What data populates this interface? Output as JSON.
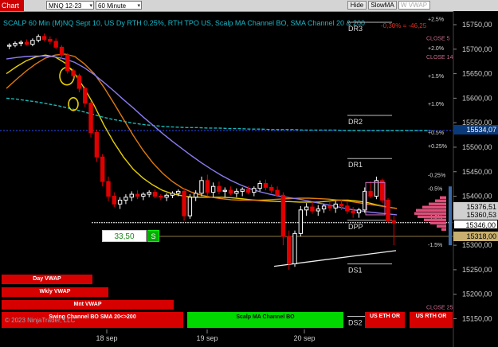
{
  "toolbar": {
    "chart_tab": "Chart",
    "instrument": "MNQ 12-23",
    "interval": "60 Minute",
    "hide_btn": "Hide",
    "slowma_btn": "SlowMA",
    "wvwap_btn": "W VWAP"
  },
  "title": "SCALP 60 Min (M)NQ Sept 10, US Dy RTH 0.25%, RTH TPO US, Scalp MA Channel BO, SMA Channel 20 & 200",
  "change_readout": "-0,30% = -46,25",
  "percent_labels": [
    "+2.5%",
    "+2.0%",
    "+1.5%",
    "+1.0%",
    "+0.5%",
    "+0.25%",
    "-0.25%",
    "-0.5%",
    "-1.0%",
    "-1.5%"
  ],
  "close_labels": [
    "CLOSE 5",
    "CLOSE 14",
    "CLOSE 25"
  ],
  "level_labels": [
    "DR3",
    "DR2",
    "DR1",
    "DPP",
    "DS1",
    "DS2"
  ],
  "y_ticks": [
    "15750,00",
    "15700,00",
    "15650,00",
    "15600,00",
    "15550,00",
    "15500,00",
    "15450,00",
    "15400,00",
    "15350,00",
    "15300,00",
    "15250,00",
    "15200,00",
    "15150,00"
  ],
  "x_ticks": [
    "18 sep",
    "19 sep",
    "20 sep"
  ],
  "price_badges": {
    "blue_line": "15534,07",
    "current": "15346,00",
    "entry": "15318,00",
    "partial_1": "15360,53",
    "partial_2": "15376,51"
  },
  "order_qty": "33,50",
  "order_qty_btn": "S",
  "buttons": {
    "day_vwap": "Day VWAP",
    "wkly_vwap": "Wkly VWAP",
    "mnt_vwap": "Mnt VWAP",
    "swing_channel": "Swing Channel BO SMA 20<>200",
    "scalp_ma": "Scalp MA Channel BO",
    "us_eth_or": "US ETH OR",
    "us_rth_or": "US RTH OR"
  },
  "copyright": "© 2023 NinjaTrader, LLC",
  "colors": {
    "up_candle": "#ffffff",
    "down_candle": "#e00000",
    "yellow_ma": "#e8d000",
    "orange_ma": "#e07a10",
    "purple_ma": "#8a7cf0",
    "teal_ma": "#18b8b8",
    "blue_level": "#2a4fff",
    "button_red": "#d60000",
    "button_green": "#00d800"
  },
  "chart_data": {
    "type": "candlestick",
    "title": "SCALP 60 Min (M)NQ Sept 10, US Dy RTH 0.25%, RTH TPO US, Scalp MA Channel BO, SMA Channel 20 & 200",
    "ylim": [
      15130,
      15770
    ],
    "x_categories": [
      "18 sep",
      "19 sep",
      "20 sep"
    ],
    "candles": [
      [
        15706,
        15712,
        15700,
        15708
      ],
      [
        15708,
        15716,
        15704,
        15712
      ],
      [
        15712,
        15718,
        15706,
        15714
      ],
      [
        15714,
        15720,
        15708,
        15710
      ],
      [
        15710,
        15722,
        15706,
        15718
      ],
      [
        15718,
        15730,
        15714,
        15726
      ],
      [
        15726,
        15732,
        15716,
        15720
      ],
      [
        15720,
        15726,
        15710,
        15716
      ],
      [
        15716,
        15722,
        15700,
        15704
      ],
      [
        15704,
        15708,
        15680,
        15688
      ],
      [
        15688,
        15692,
        15650,
        15656
      ],
      [
        15656,
        15660,
        15640,
        15646
      ],
      [
        15646,
        15650,
        15612,
        15620
      ],
      [
        15620,
        15624,
        15582,
        15590
      ],
      [
        15590,
        15594,
        15520,
        15530
      ],
      [
        15530,
        15536,
        15470,
        15480
      ],
      [
        15480,
        15486,
        15420,
        15430
      ],
      [
        15430,
        15440,
        15390,
        15400
      ],
      [
        15400,
        15408,
        15378,
        15384
      ],
      [
        15384,
        15398,
        15374,
        15392
      ],
      [
        15392,
        15404,
        15384,
        15398
      ],
      [
        15398,
        15410,
        15390,
        15404
      ],
      [
        15404,
        15412,
        15394,
        15400
      ],
      [
        15400,
        15408,
        15392,
        15404
      ],
      [
        15404,
        15412,
        15398,
        15408
      ],
      [
        15408,
        15414,
        15396,
        15400
      ],
      [
        15400,
        15404,
        15392,
        15398
      ],
      [
        15398,
        15406,
        15390,
        15402
      ],
      [
        15402,
        15410,
        15396,
        15406
      ],
      [
        15406,
        15414,
        15400,
        15410
      ],
      [
        15410,
        15416,
        15350,
        15360
      ],
      [
        15360,
        15404,
        15354,
        15398
      ],
      [
        15398,
        15412,
        15390,
        15406
      ],
      [
        15406,
        15440,
        15400,
        15432
      ],
      [
        15432,
        15444,
        15400,
        15408
      ],
      [
        15408,
        15428,
        15398,
        15420
      ],
      [
        15420,
        15430,
        15404,
        15410
      ],
      [
        15410,
        15418,
        15398,
        15412
      ],
      [
        15412,
        15420,
        15402,
        15406
      ],
      [
        15406,
        15416,
        15398,
        15410
      ],
      [
        15410,
        15418,
        15400,
        15414
      ],
      [
        15414,
        15420,
        15404,
        15408
      ],
      [
        15408,
        15420,
        15400,
        15416
      ],
      [
        15416,
        15432,
        15410,
        15426
      ],
      [
        15426,
        15434,
        15412,
        15418
      ],
      [
        15418,
        15424,
        15406,
        15412
      ],
      [
        15412,
        15420,
        15398,
        15402
      ],
      [
        15402,
        15408,
        15300,
        15318
      ],
      [
        15318,
        15330,
        15250,
        15262
      ],
      [
        15262,
        15330,
        15256,
        15324
      ],
      [
        15324,
        15380,
        15318,
        15372
      ],
      [
        15372,
        15386,
        15360,
        15378
      ],
      [
        15378,
        15388,
        15364,
        15370
      ],
      [
        15370,
        15382,
        15360,
        15374
      ],
      [
        15374,
        15384,
        15366,
        15380
      ],
      [
        15380,
        15388,
        15370,
        15376
      ],
      [
        15376,
        15390,
        15366,
        15384
      ],
      [
        15384,
        15392,
        15372,
        15380
      ],
      [
        15380,
        15388,
        15364,
        15370
      ],
      [
        15370,
        15378,
        15356,
        15366
      ],
      [
        15366,
        15376,
        15356,
        15372
      ],
      [
        15372,
        15418,
        15366,
        15410
      ],
      [
        15410,
        15430,
        15396,
        15400
      ],
      [
        15400,
        15440,
        15394,
        15432
      ],
      [
        15432,
        15436,
        15386,
        15392
      ],
      [
        15392,
        15396,
        15346,
        15350
      ],
      [
        15350,
        15360,
        15300,
        15346
      ]
    ],
    "lines": {
      "yellow_ma": [
        15650,
        15664,
        15676,
        15684,
        15688,
        15684,
        15672,
        15650,
        15620,
        15585,
        15545,
        15510,
        15480,
        15455,
        15437,
        15423,
        15412,
        15405,
        15401,
        15398,
        15398,
        15398,
        15398,
        15397,
        15395,
        15393,
        15391,
        15390,
        15389,
        15389,
        15388,
        15388,
        15388,
        15390,
        15392,
        15392,
        15390,
        15387,
        15382,
        15378,
        15375
      ],
      "orange_ma": [
        15620,
        15638,
        15655,
        15670,
        15682,
        15688,
        15690,
        15685,
        15670,
        15650,
        15622,
        15590,
        15557,
        15524,
        15494,
        15468,
        15447,
        15430,
        15417,
        15408,
        15402,
        15398,
        15395,
        15393,
        15392,
        15392,
        15392,
        15393,
        15394,
        15395,
        15396,
        15396,
        15395,
        15394,
        15392,
        15390,
        15387,
        15384,
        15381,
        15378,
        15375
      ],
      "purple_ma": [
        15680,
        15683,
        15685,
        15686,
        15686,
        15684,
        15680,
        15673,
        15662,
        15648,
        15632,
        15615,
        15597,
        15580,
        15562,
        15545,
        15528,
        15512,
        15497,
        15482,
        15468,
        15455,
        15443,
        15432,
        15423,
        15415,
        15409,
        15404,
        15400,
        15397,
        15394,
        15390,
        15386,
        15382,
        15378,
        15374,
        15371,
        15368,
        15366,
        15364,
        15362
      ],
      "teal_ma": [
        15600,
        15598,
        15595,
        15592,
        15588,
        15584,
        15579,
        15574,
        15568,
        15562,
        15557,
        15553,
        15549,
        15546,
        15544,
        15542,
        15541,
        15540,
        15540,
        15539,
        15539,
        15538,
        15538,
        15537,
        15537,
        15536,
        15536,
        15536,
        15535,
        15535,
        15535,
        15535,
        15534,
        15534,
        15534,
        15534,
        15534,
        15534,
        15534,
        15534,
        15534
      ]
    },
    "levels": {
      "DR3": 15750,
      "DR2": 15560,
      "DR1": 15472,
      "DPP": 15346,
      "DS1": 15257,
      "DS2": 15150,
      "blue_level": 15534.07,
      "entry": 15318
    }
  }
}
